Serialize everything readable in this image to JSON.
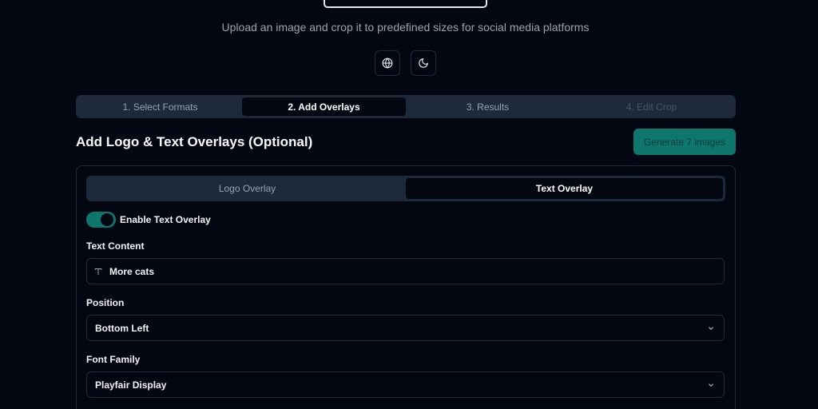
{
  "header": {
    "subtitle": "Upload an image and crop it to predefined sizes for social media platforms",
    "icons": [
      "globe-icon",
      "moon-icon"
    ]
  },
  "steps": [
    {
      "label": "1. Select Formats"
    },
    {
      "label": "2. Add Overlays"
    },
    {
      "label": "3. Results"
    },
    {
      "label": "4. Edit Crop"
    }
  ],
  "section": {
    "title": "Add Logo & Text Overlays (Optional)",
    "generate_label": "Generate 7 images"
  },
  "overlay_tabs": [
    {
      "label": "Logo Overlay"
    },
    {
      "label": "Text Overlay"
    }
  ],
  "text_overlay": {
    "enable_label": "Enable Text Overlay",
    "enabled": true,
    "content_label": "Text Content",
    "content_value": "More cats",
    "position_label": "Position",
    "position_value": "Bottom Left",
    "font_family_label": "Font Family",
    "font_family_value": "Playfair Display"
  },
  "colors": {
    "background": "#030712",
    "accent": "#0f766e",
    "muted_bar": "#1e293b"
  }
}
